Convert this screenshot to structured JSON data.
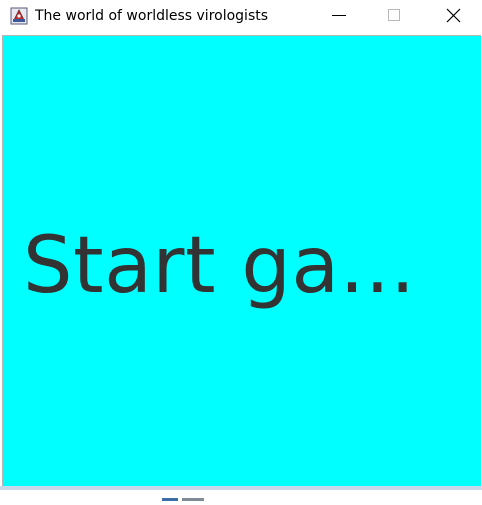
{
  "window": {
    "title": "The world of worldless virologists",
    "icon": "java-app-icon",
    "controls": {
      "minimize_icon": "minimize-icon",
      "maximize_icon": "maximize-icon",
      "close_icon": "close-icon"
    }
  },
  "main": {
    "start_label": "Start ga...",
    "background_color": "#00ffff",
    "text_color": "#333333"
  }
}
